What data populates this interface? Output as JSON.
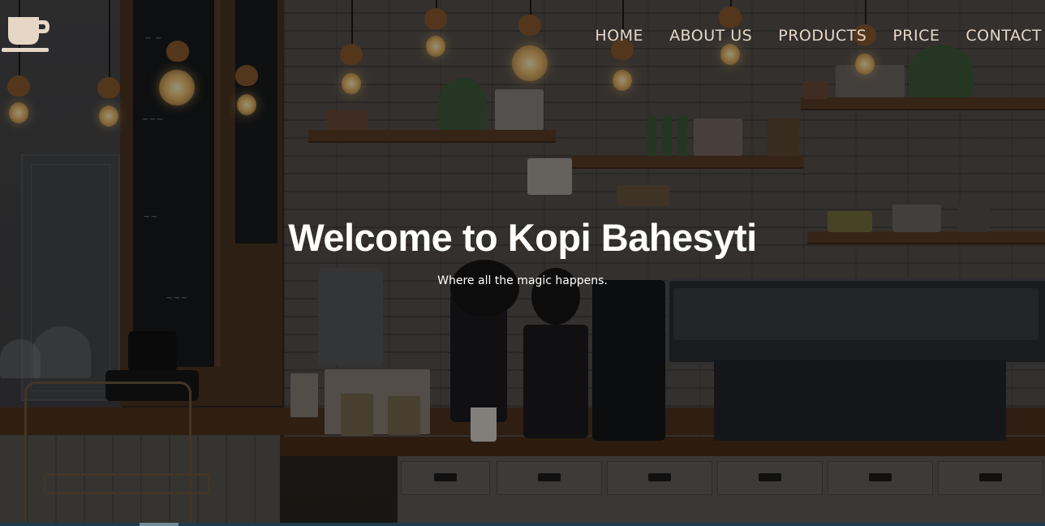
{
  "brand": {
    "logo_icon": "coffee-cup-icon",
    "logo_color": "#e6d6c6"
  },
  "nav": {
    "items": [
      {
        "label": "HOME"
      },
      {
        "label": "ABOUT US"
      },
      {
        "label": "PRODUCTS"
      },
      {
        "label": "PRICE"
      },
      {
        "label": "CONTACT"
      }
    ],
    "text_color": "#e6d6c6"
  },
  "hero": {
    "title": "Welcome to Kopi Bahesyti",
    "subtitle": "Where all the magic happens."
  },
  "background": {
    "description_icon": "cafe-interior-background",
    "overlay_color": "#000000"
  }
}
